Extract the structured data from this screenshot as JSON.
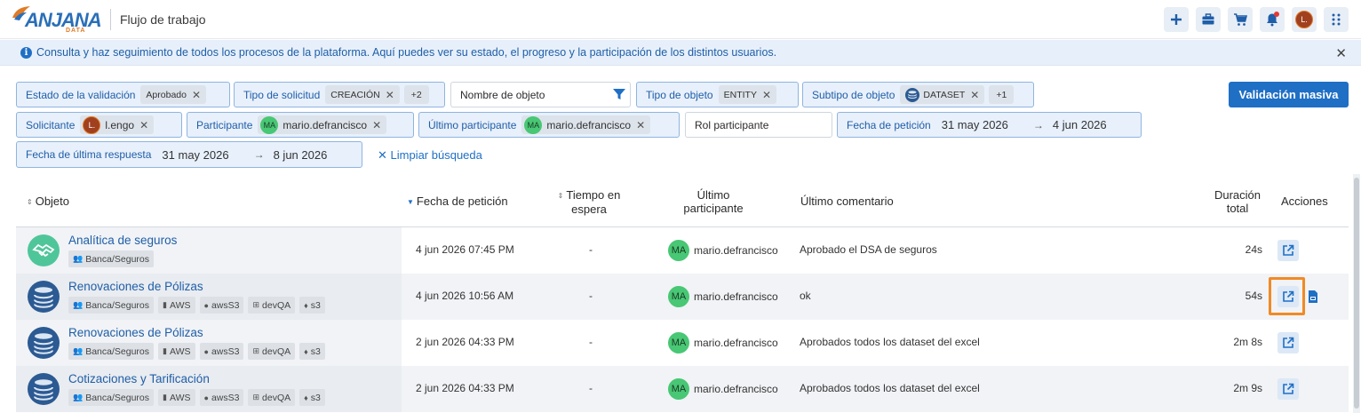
{
  "header": {
    "logo_text": "ANJANA",
    "logo_sub": "DATA",
    "title": "Flujo de trabajo",
    "avatar_initial": "L.",
    "icons": [
      "plus-icon",
      "briefcase-icon",
      "cart-icon",
      "bell-icon",
      "grid-icon"
    ]
  },
  "banner": {
    "text": "Consulta y haz seguimiento de todos los procesos de la plataforma. Aquí puedes ver su estado, el progreso y la participación de los distintos usuarios."
  },
  "filters": {
    "estado": {
      "label": "Estado de la validación",
      "value": "Aprobado"
    },
    "tipo_solicitud": {
      "label": "Tipo de solicitud",
      "value": "CREACIÓN",
      "more": "+2"
    },
    "nombre_objeto": {
      "placeholder": "Nombre de objeto"
    },
    "tipo_objeto": {
      "label": "Tipo de objeto",
      "value": "ENTITY"
    },
    "subtipo": {
      "label": "Subtipo de objeto",
      "value": "DATASET",
      "more": "+1"
    },
    "solicitante": {
      "label": "Solicitante",
      "avatar": "L.",
      "value": "l.engo"
    },
    "participante": {
      "label": "Participante",
      "avatar": "MA",
      "value": "mario.defrancisco"
    },
    "ultimo_participante": {
      "label": "Último participante",
      "avatar": "MA",
      "value": "mario.defrancisco"
    },
    "rol": {
      "placeholder": "Rol participante"
    },
    "fecha_peticion": {
      "label": "Fecha de petición",
      "from": "31 may 2026",
      "to": "4 jun 2026"
    },
    "fecha_respuesta": {
      "label": "Fecha de última respuesta",
      "from": "31 may 2026",
      "to": "8 jun 2026"
    },
    "clear": "Limpiar búsqueda",
    "bulk": "Validación masiva"
  },
  "table": {
    "headers": {
      "objeto": "Objeto",
      "fecha": "Fecha de petición",
      "tiempo_1": "Tiempo en",
      "tiempo_2": "espera",
      "ultimo_1": "Último",
      "ultimo_2": "participante",
      "comentario": "Último comentario",
      "duracion_1": "Duración",
      "duracion_2": "total",
      "acciones": "Acciones"
    },
    "rows": [
      {
        "name": "Analítica de seguros",
        "icon": "handshake-icon",
        "tags": [
          "Banca/Seguros"
        ],
        "fecha": "4 jun 2026 07:45 PM",
        "espera": "-",
        "avatar": "MA",
        "participante": "mario.defrancisco",
        "comentario": "Aprobado el DSA de seguros",
        "duracion": "24s"
      },
      {
        "name": "Renovaciones de Pólizas",
        "icon": "database-icon",
        "tags": [
          "Banca/Seguros",
          "AWS",
          "awsS3",
          "devQA",
          "s3"
        ],
        "fecha": "4 jun 2026 10:56 AM",
        "espera": "-",
        "avatar": "MA",
        "participante": "mario.defrancisco",
        "comentario": "ok",
        "duracion": "54s"
      },
      {
        "name": "Renovaciones de Pólizas",
        "icon": "database-icon",
        "tags": [
          "Banca/Seguros",
          "AWS",
          "awsS3",
          "devQA",
          "s3"
        ],
        "fecha": "2 jun 2026 04:33 PM",
        "espera": "-",
        "avatar": "MA",
        "participante": "mario.defrancisco",
        "comentario": "Aprobados todos los dataset del excel",
        "duracion": "2m 8s"
      },
      {
        "name": "Cotizaciones y Tarificación",
        "icon": "database-icon",
        "tags": [
          "Banca/Seguros",
          "AWS",
          "awsS3",
          "devQA",
          "s3"
        ],
        "fecha": "2 jun 2026 04:33 PM",
        "espera": "-",
        "avatar": "MA",
        "participante": "mario.defrancisco",
        "comentario": "Aprobados todos los dataset del excel",
        "duracion": "2m 9s"
      }
    ]
  }
}
